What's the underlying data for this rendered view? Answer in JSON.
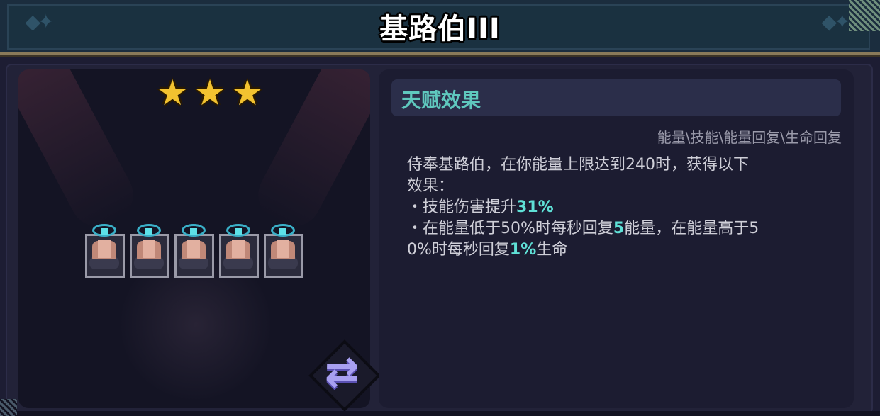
{
  "header": {
    "title": "基路伯III"
  },
  "hero": {
    "stars": 3,
    "star_glyph": "★",
    "unit_count": 5
  },
  "swap_button": {
    "glyph": "⇄"
  },
  "talent": {
    "title": "天赋效果",
    "tags": "能量\\技能\\能量回复\\生命回复",
    "line1": "侍奉基路伯，在你能量上限达到240时，获得以下",
    "line2": "效果：",
    "line3_prefix": "・技能伤害提升",
    "line3_value": "31%",
    "line4_prefix": "・在能量低于50%时每秒回复",
    "line4_value": "5",
    "line4_suffix": "能量，在能量高于5",
    "line5_prefix": "0%时每秒回复",
    "line5_value": "1%",
    "line5_suffix": "生命"
  },
  "colors": {
    "accent": "#5fc8be",
    "highlight": "#5fe0d6",
    "star": "#f2c230"
  }
}
